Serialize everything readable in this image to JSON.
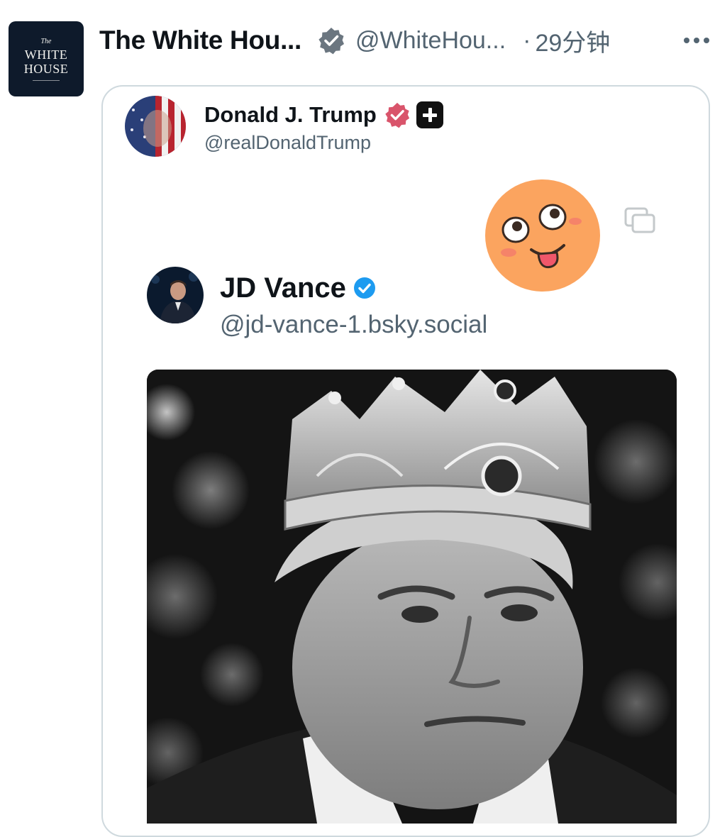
{
  "tweet": {
    "author": {
      "display_name": "The White Hou...",
      "handle": "@WhiteHou...",
      "avatar": {
        "logo_line_small": "The",
        "logo_line1": "WHITE",
        "logo_line2": "HOUSE"
      },
      "verified_badge": "gray-check-badge-icon"
    },
    "separator": "·",
    "time": "29分钟",
    "more_icon": "more-horizontal-icon"
  },
  "quote": {
    "author": {
      "display_name": "Donald J. Trump",
      "handle": "@realDonaldTrump",
      "verified_badge": "red-check-badge-icon",
      "affiliation_badge": "government-affiliate-icon"
    },
    "sticker": "tongue-out-emoji-icon",
    "copy_icon": "copy-icon",
    "inner_quote": {
      "author": {
        "display_name": "JD Vance",
        "handle": "@jd-vance-1.bsky.social",
        "verified_badge": "blue-check-badge-icon"
      },
      "media_description_icon": "crowned-portrait-image"
    }
  },
  "colors": {
    "text_primary": "#0f1419",
    "text_secondary": "#536471",
    "border": "#cfd9de",
    "verified_gray": "#6b7680",
    "verified_red": "#d9546b",
    "verified_blue": "#1d9bf0",
    "emoji_orange": "#fba45f"
  }
}
